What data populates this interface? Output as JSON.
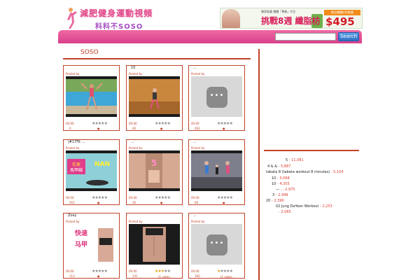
{
  "header": {
    "logo_line1": "減肥健身運動視頻",
    "logo_line2": "科科不SOSO"
  },
  "banner": {
    "small_text": "獨家推薦 纖體「專業」代言",
    "headline": "挑戰8週 纖脂枋",
    "tag": "最佳纖體好評推薦",
    "price": "$495"
  },
  "search": {
    "placeholder": "",
    "button_label": "Search"
  },
  "section": {
    "title": "SOSO"
  },
  "videos": [
    {
      "title": "",
      "posted_by": "Posted by",
      "duration": "00:00",
      "views": "0",
      "rating": 0,
      "votes": "",
      "thumb": "pool"
    },
    {
      "title": "10",
      "posted_by": "Posted by",
      "duration": "00:00",
      "views": "46",
      "rating": 0,
      "votes": "",
      "thumb": "gym"
    },
    {
      "title": "...",
      "posted_by": "Posted by",
      "duration": "00:00",
      "views": "262",
      "rating": 0,
      "votes": "",
      "thumb": "placeholder"
    },
    {
      "title": "|#17Fit ...",
      "posted_by": "Posted by",
      "duration": "00:00",
      "views": "263",
      "rating": 0,
      "votes": "",
      "thumb": "banner-yoga"
    },
    {
      "title": "...",
      "posted_by": "Posted by",
      "duration": "00:00",
      "views": "30",
      "rating": 0,
      "votes": "",
      "thumb": "abs"
    },
    {
      "title": "...",
      "posted_by": "Posted by",
      "duration": "00:00",
      "views": "66",
      "rating": 0,
      "votes": "",
      "thumb": "group"
    },
    {
      "title": "Zoey",
      "posted_by": "Posted by",
      "duration": "00:00",
      "views": "113",
      "rating": 0,
      "votes": "",
      "thumb": "vest"
    },
    {
      "title": "",
      "posted_by": "Posted by",
      "duration": "00:00",
      "views": "141",
      "rating": 3,
      "votes": "(1 votes...",
      "thumb": "torso"
    },
    {
      "title": "...",
      "posted_by": "Posted by",
      "duration": "00:00",
      "views": "160",
      "rating": 1,
      "votes": "(1 votes...",
      "thumb": "placeholder"
    }
  ],
  "ranking": [
    {
      "label": "5",
      "count": "- 11,081"
    },
    {
      "label": "4 &   &",
      "count": "- 5,887"
    },
    {
      "label": "tabata 8   (tabata workout 8 minutes)",
      "count": "- 5,104"
    },
    {
      "label": "10",
      "count": "- 5,068"
    },
    {
      "label": "10",
      "count": "- 4,355"
    },
    {
      "label": "— .",
      "count": "- 2,975"
    },
    {
      "label": "3",
      "count": "- 2,948"
    },
    {
      "label": "20",
      "count": "- 2,390"
    },
    {
      "label": "02       Jung DaYeon Workout",
      "count": "- 2,253"
    },
    {
      "label": "",
      "count": "- 2,065"
    }
  ]
}
